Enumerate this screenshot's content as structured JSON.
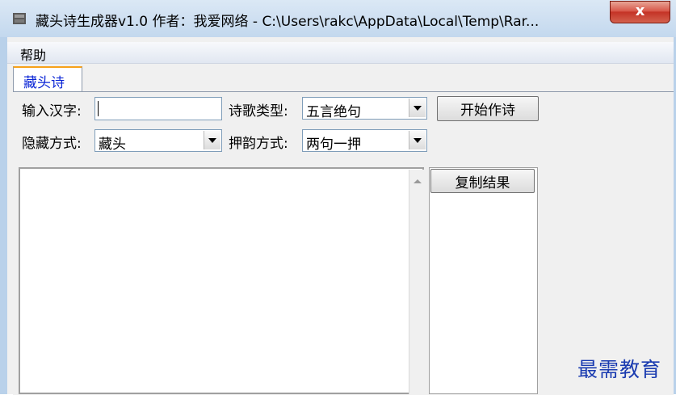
{
  "window": {
    "title": "藏头诗生成器v1.0  作者：我爱网络 - C:\\Users\\rakc\\AppData\\Local\\Temp\\Rar...",
    "close_label": "x"
  },
  "menu": {
    "items": [
      "帮助"
    ]
  },
  "tabs": [
    {
      "label": "藏头诗"
    }
  ],
  "form": {
    "input_label": "输入汉字:",
    "input_value": "",
    "poem_type_label": "诗歌类型:",
    "poem_type_value": "五言绝句",
    "start_button": "开始作诗",
    "hide_mode_label": "隐藏方式:",
    "hide_mode_value": "藏头",
    "rhyme_label": "押韵方式:",
    "rhyme_value": "两句一押",
    "copy_button": "复制结果"
  },
  "watermark": "最需教育",
  "colors": {
    "tab_text": "#0b26d6",
    "tab_accent": "#f7a11a",
    "watermark": "#1a3bb0",
    "close_button": "#c43326"
  }
}
